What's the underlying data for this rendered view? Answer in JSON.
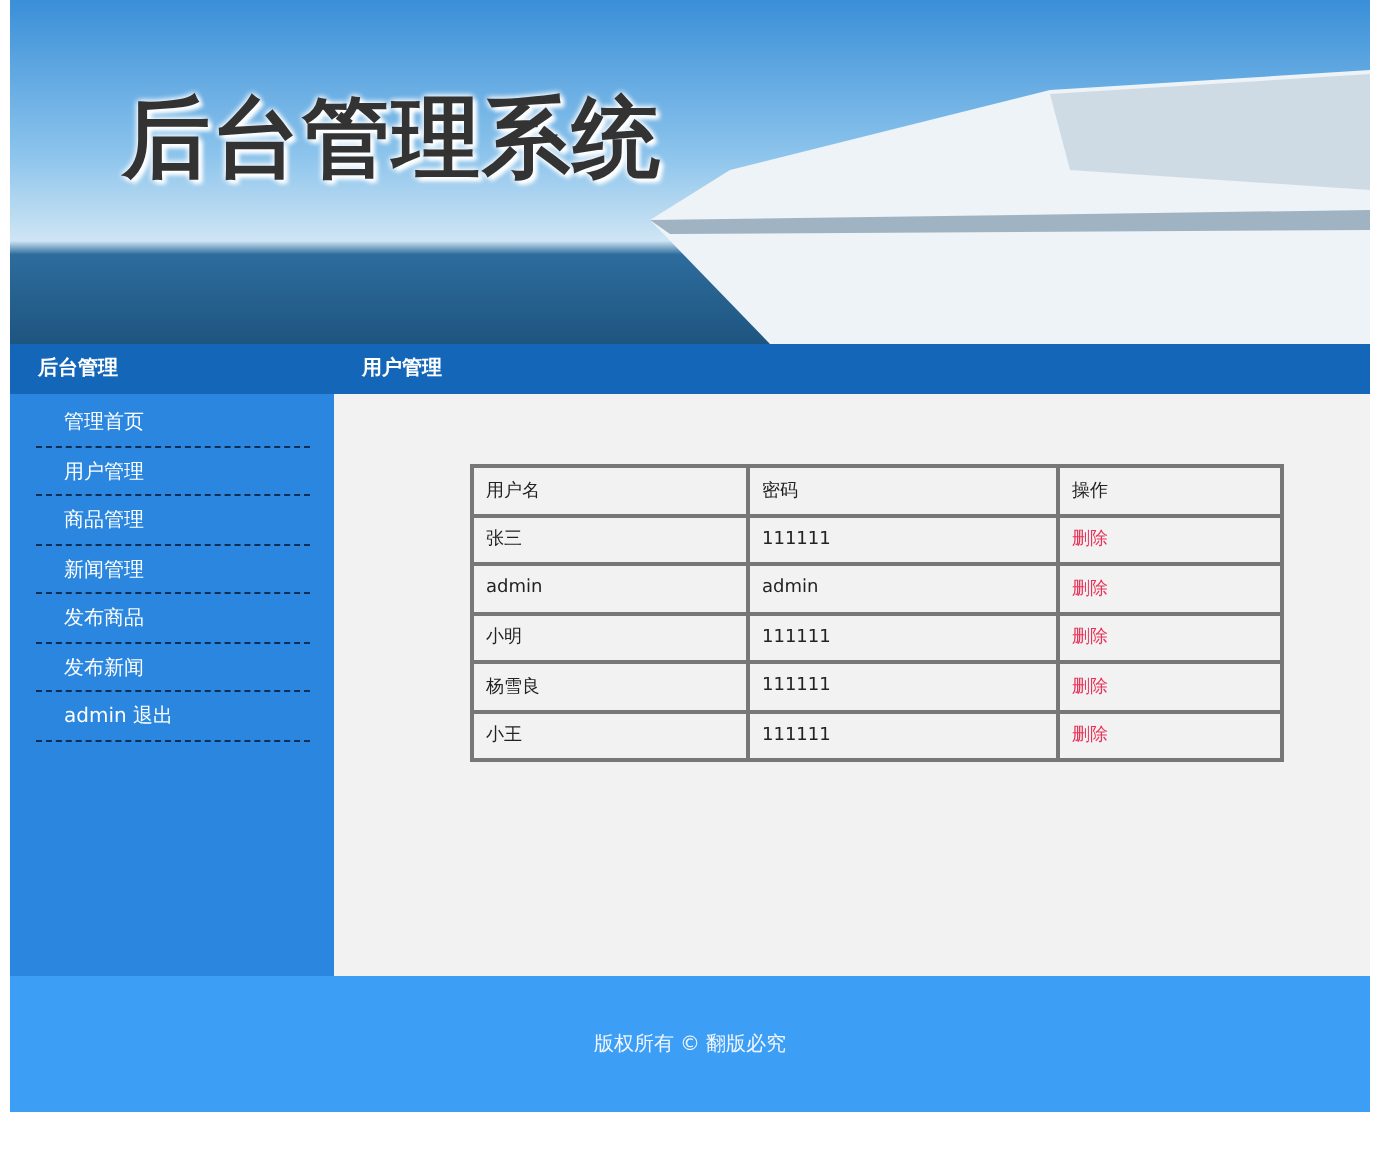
{
  "banner": {
    "title": "后台管理系统"
  },
  "sidebar": {
    "heading": "后台管理",
    "items": [
      {
        "label": "管理首页",
        "selected": false
      },
      {
        "label": "用户管理",
        "selected": false
      },
      {
        "label": "商品管理",
        "selected": false
      },
      {
        "label": "新闻管理",
        "selected": false
      },
      {
        "label": "发布商品",
        "selected": false
      },
      {
        "label": "发布新闻",
        "selected": false
      },
      {
        "label": "admin 退出",
        "selected": false
      }
    ]
  },
  "content": {
    "heading": "用户管理"
  },
  "table": {
    "columns": [
      "用户名",
      "密码",
      "操作"
    ],
    "rows": [
      {
        "username": "张三",
        "password": "111111",
        "action": "删除"
      },
      {
        "username": "admin",
        "password": "admin",
        "action": "删除"
      },
      {
        "username": "小明",
        "password": "111111",
        "action": "删除"
      },
      {
        "username": "杨雪良",
        "password": "111111",
        "action": "删除"
      },
      {
        "username": "小王",
        "password": "111111",
        "action": "删除"
      }
    ]
  },
  "footer": {
    "text": "版权所有 © 翻版必究"
  }
}
